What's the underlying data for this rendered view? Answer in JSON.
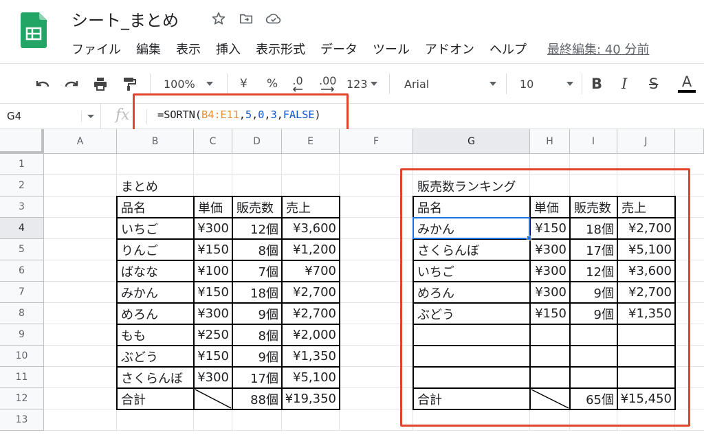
{
  "app": {
    "doc_title": "シート_まとめ",
    "icons": [
      "star-icon",
      "move-folder-icon",
      "cloud-saved-icon"
    ]
  },
  "menu": {
    "items": [
      "ファイル",
      "編集",
      "表示",
      "挿入",
      "表示形式",
      "データ",
      "ツール",
      "アドオン",
      "ヘルプ"
    ],
    "last_edit": "最終編集: 40 分前"
  },
  "toolbar": {
    "zoom": "100%",
    "currency": "¥",
    "percent": "%",
    "dec_decrease": ".0",
    "dec_increase": ".00",
    "more_formats": "123",
    "font": "Arial",
    "font_size": "10",
    "bold": "B",
    "italic": "I",
    "strike": "S",
    "text_color": "A"
  },
  "formula_bar": {
    "name_box": "G4",
    "fx": "fx",
    "formula_prefix": "=SORTN(",
    "formula_range": "B4:E11",
    "formula_c1": ",",
    "formula_n1": "5",
    "formula_c2": ",",
    "formula_n2": "0",
    "formula_c3": ",",
    "formula_n3": "3",
    "formula_c4": ",",
    "formula_bool": "FALSE",
    "formula_suffix": ")"
  },
  "grid": {
    "columns": [
      "A",
      "B",
      "C",
      "D",
      "E",
      "F",
      "G",
      "H",
      "I",
      "J"
    ],
    "rows": [
      "1",
      "2",
      "3",
      "4",
      "5",
      "6",
      "7",
      "8",
      "9",
      "10",
      "11",
      "12",
      "13"
    ],
    "selected_cell": "G4"
  },
  "summary_table": {
    "title": "まとめ",
    "headers": [
      "品名",
      "単価",
      "販売数",
      "売上"
    ],
    "rows": [
      [
        "いちご",
        "¥300",
        "12個",
        "¥3,600"
      ],
      [
        "りんご",
        "¥150",
        "8個",
        "¥1,200"
      ],
      [
        "ばなな",
        "¥100",
        "7個",
        "¥700"
      ],
      [
        "みかん",
        "¥150",
        "18個",
        "¥2,700"
      ],
      [
        "めろん",
        "¥300",
        "9個",
        "¥2,700"
      ],
      [
        "もも",
        "¥250",
        "8個",
        "¥2,000"
      ],
      [
        "ぶどう",
        "¥150",
        "9個",
        "¥1,350"
      ],
      [
        "さくらんぼ",
        "¥300",
        "17個",
        "¥5,100"
      ]
    ],
    "total": [
      "合計",
      "",
      "88個",
      "¥19,350"
    ]
  },
  "ranking_table": {
    "title": "販売数ランキング",
    "headers": [
      "品名",
      "単価",
      "販売数",
      "売上"
    ],
    "rows": [
      [
        "みかん",
        "¥150",
        "18個",
        "¥2,700"
      ],
      [
        "さくらんぼ",
        "¥300",
        "17個",
        "¥5,100"
      ],
      [
        "いちご",
        "¥300",
        "12個",
        "¥3,600"
      ],
      [
        "めろん",
        "¥300",
        "9個",
        "¥2,700"
      ],
      [
        "ぶどう",
        "¥150",
        "9個",
        "¥1,350"
      ],
      [
        "",
        "",
        "",
        ""
      ],
      [
        "",
        "",
        "",
        ""
      ],
      [
        "",
        "",
        "",
        ""
      ]
    ],
    "total": [
      "合計",
      "",
      "65個",
      "¥15,450"
    ]
  },
  "colors": {
    "sheets_green": "#23a566",
    "highlight_red": "#e0452c",
    "selection_blue": "#1a73e8",
    "range_orange": "#e69138",
    "number_blue": "#1155cc"
  }
}
